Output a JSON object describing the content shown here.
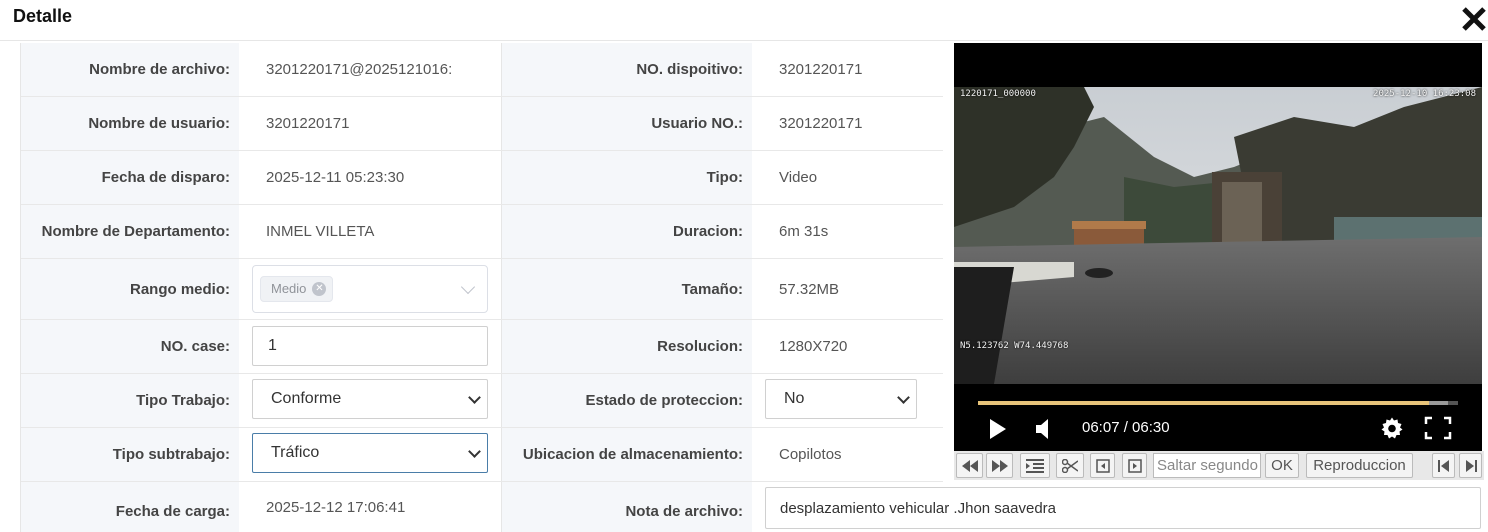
{
  "dialog": {
    "title": "Detalle",
    "close_icon": "close-icon"
  },
  "fields": {
    "nombre_archivo": {
      "label": "Nombre de archivo:",
      "value": "3201220171@2025121016:"
    },
    "no_dispositivo": {
      "label": "NO. dispoitivo:",
      "value": "3201220171"
    },
    "nombre_usuario": {
      "label": "Nombre de usuario:",
      "value": "3201220171"
    },
    "usuario_no": {
      "label": "Usuario NO.:",
      "value": "3201220171"
    },
    "fecha_disparo": {
      "label": "Fecha de disparo:",
      "value": "2025-12-11 05:23:30"
    },
    "tipo": {
      "label": "Tipo:",
      "value": "Video"
    },
    "departamento": {
      "label": "Nombre de Departamento:",
      "value": "INMEL VILLETA"
    },
    "duracion": {
      "label": "Duracion:",
      "value": "6m 31s"
    },
    "rango_medio": {
      "label": "Rango medio:",
      "tag": "Medio"
    },
    "tamano": {
      "label": "Tamaño:",
      "value": "57.32MB"
    },
    "no_case": {
      "label": "NO. case:",
      "value": "1"
    },
    "resolucion": {
      "label": "Resolucion:",
      "value": "1280X720"
    },
    "tipo_trabajo": {
      "label": "Tipo Trabajo:",
      "value": "Conforme"
    },
    "estado_proteccion": {
      "label": "Estado de proteccion:",
      "value": "No"
    },
    "tipo_subtrabajo": {
      "label": "Tipo subtrabajo:",
      "value": "Tráfico"
    },
    "ubicacion": {
      "label": "Ubicacion de almacenamiento:",
      "value": "Copilotos"
    },
    "fecha_carga": {
      "label": "Fecha de carga:",
      "value": "2025-12-12 17:06:41"
    },
    "nota": {
      "label": "Nota de archivo:",
      "value": "desplazamiento vehicular .Jhon saavedra"
    }
  },
  "player": {
    "osd_top_left": "1220171_000000",
    "osd_top_right": "2025-12-10 16:23:08",
    "osd_bottom_left": "N5.123762  W74.449768",
    "time": "06:07 / 06:30",
    "progress": 0.94,
    "buffered": 0.98
  },
  "toolbar": {
    "seek_placeholder": "Saltar segundo",
    "ok_label": "OK",
    "playback_label": "Reproduccion"
  }
}
